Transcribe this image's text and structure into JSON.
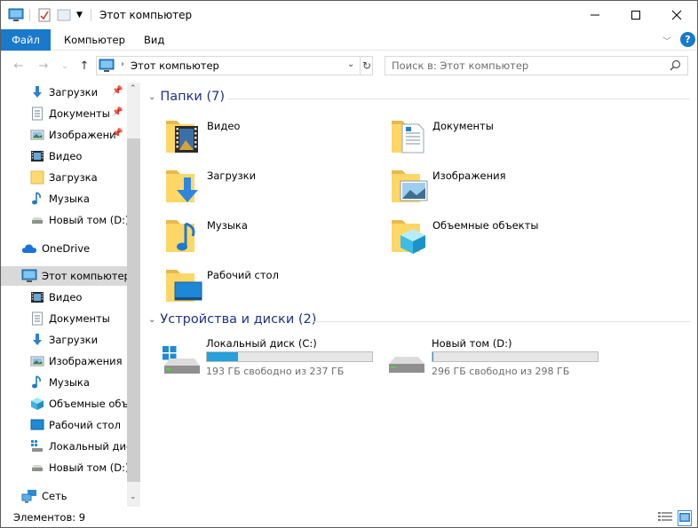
{
  "window": {
    "title": "Этот компьютер",
    "controls": [
      "minimize",
      "maximize",
      "close"
    ]
  },
  "ribbon": {
    "tabs": [
      {
        "label": "Файл",
        "active": true
      },
      {
        "label": "Компьютер"
      },
      {
        "label": "Вид"
      }
    ],
    "accent": "#1979ca"
  },
  "address": {
    "path": "Этот компьютер",
    "search_placeholder": "Поиск в: Этот компьютер"
  },
  "sidebar": {
    "items": [
      {
        "label": "Загрузки",
        "icon": "download-icon",
        "pinned": true
      },
      {
        "label": "Документы",
        "icon": "document-icon",
        "pinned": true
      },
      {
        "label": "Изображени",
        "icon": "pictures-icon",
        "pinned": true
      },
      {
        "label": "Видео",
        "icon": "video-icon"
      },
      {
        "label": "Загрузка",
        "icon": "folder-icon"
      },
      {
        "label": "Музыка",
        "icon": "music-icon"
      },
      {
        "label": "Новый том (D:)",
        "icon": "drive-icon"
      },
      {
        "label": "OneDrive",
        "icon": "cloud-icon"
      },
      {
        "label": "Этот компьютер",
        "icon": "computer-icon",
        "selected": true
      },
      {
        "label": "Видео",
        "icon": "video-icon"
      },
      {
        "label": "Документы",
        "icon": "document-icon"
      },
      {
        "label": "Загрузки",
        "icon": "download-icon"
      },
      {
        "label": "Изображения",
        "icon": "pictures-icon"
      },
      {
        "label": "Музыка",
        "icon": "music-icon"
      },
      {
        "label": "Объемные объе",
        "icon": "cube-icon"
      },
      {
        "label": "Рабочий стол",
        "icon": "desktop-icon"
      },
      {
        "label": "Локальный дис",
        "icon": "windows-drive-icon"
      },
      {
        "label": "Новый том (D:)",
        "icon": "drive-icon"
      },
      {
        "label": "Сеть",
        "icon": "network-icon"
      }
    ]
  },
  "folders": {
    "header": "Папки (7)",
    "items": [
      {
        "label": "Видео",
        "icon": "video-folder-icon"
      },
      {
        "label": "Документы",
        "icon": "documents-folder-icon"
      },
      {
        "label": "Загрузки",
        "icon": "downloads-folder-icon"
      },
      {
        "label": "Изображения",
        "icon": "pictures-folder-icon"
      },
      {
        "label": "Музыка",
        "icon": "music-folder-icon"
      },
      {
        "label": "Объемные объекты",
        "icon": "3d-objects-folder-icon"
      },
      {
        "label": "Рабочий стол",
        "icon": "desktop-folder-icon"
      }
    ]
  },
  "devices": {
    "header": "Устройства и диски (2)",
    "items": [
      {
        "label": "Локальный диск (C:)",
        "free_text": "193 ГБ свободно из 237 ГБ",
        "used_fraction": 0.19,
        "icon": "windows-drive-icon"
      },
      {
        "label": "Новый том (D:)",
        "free_text": "296 ГБ свободно из 298 ГБ",
        "used_fraction": 0.007,
        "icon": "drive-icon"
      }
    ]
  },
  "status": {
    "text": "Элементов: 9"
  }
}
